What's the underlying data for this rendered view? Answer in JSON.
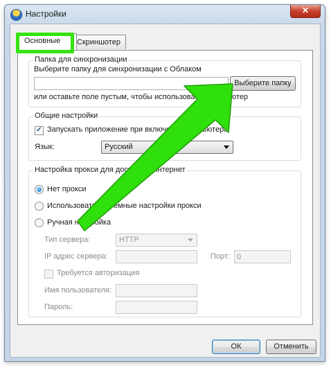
{
  "window": {
    "title": "Настройки",
    "close_glyph": "✕",
    "icon": "app-cloud-icon"
  },
  "tabs": [
    {
      "label": "Основные",
      "active": true
    },
    {
      "label": "Скриншотер",
      "active": false
    }
  ],
  "sync": {
    "group_title": "Папка для синхронизации",
    "prompt": "Выберите папку для синхронизации с Облаком",
    "folder_value": "",
    "browse_label": "Выберите папку",
    "hint": "или оставьте поле пустым, чтобы использовать Скриншотер"
  },
  "general": {
    "group_title": "Общие настройки",
    "autostart_label": "Запускать приложение при включении компьютера",
    "autostart_checked": true,
    "language_label": "Язык:",
    "language_value": "Русский"
  },
  "proxy": {
    "group_title": "Настройка прокси для доступа в Интернет",
    "options": [
      {
        "label": "Нет прокси",
        "selected": true
      },
      {
        "label": "Использовать системные настройки прокси",
        "selected": false
      },
      {
        "label": "Ручная настройка",
        "selected": false
      }
    ],
    "server_type_label": "Тип сервера:",
    "server_type_value": "HTTP",
    "server_ip_label": "IP адрес сервера:",
    "server_ip_value": "",
    "port_label": "Порт:",
    "port_value": "0",
    "auth_label": "Требуется авторизация",
    "auth_checked": false,
    "username_label": "Имя пользователя:",
    "username_value": "",
    "password_label": "Пароль:",
    "password_value": ""
  },
  "buttons": {
    "ok": "ОК",
    "cancel": "Отменить"
  },
  "annotation": {
    "arrow_color": "#2fe00c",
    "highlight_color": "#34e30f"
  }
}
